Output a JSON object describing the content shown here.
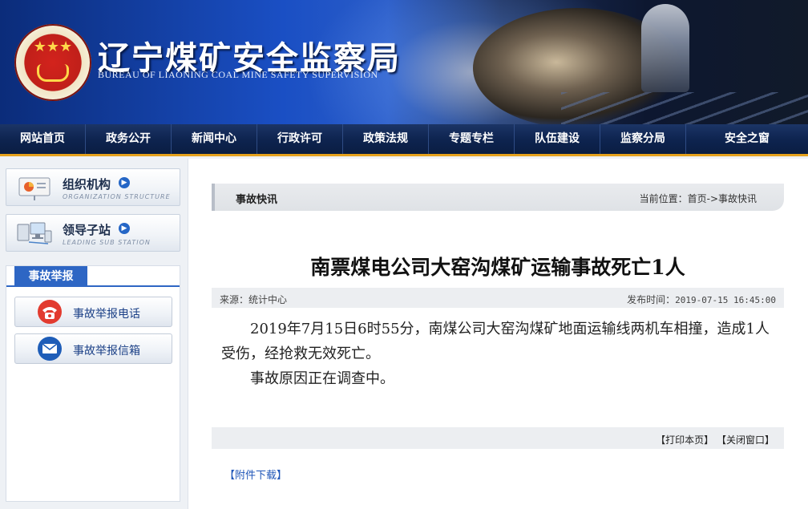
{
  "header": {
    "title": "辽宁煤矿安全监察局",
    "subtitle": "BUREAU OF LIAONING COAL MINE SAFETY SUPERVISION"
  },
  "nav": {
    "items": [
      {
        "label": "网站首页"
      },
      {
        "label": "政务公开"
      },
      {
        "label": "新闻中心"
      },
      {
        "label": "行政许可"
      },
      {
        "label": "政策法规"
      },
      {
        "label": "专题专栏"
      },
      {
        "label": "队伍建设"
      },
      {
        "label": "监察分局"
      },
      {
        "label": "安全之窗"
      }
    ]
  },
  "sidebar": {
    "org": {
      "label": "组织机构",
      "en": "ORGANIZATION STRUCTURE",
      "icon": "presentation-chart-icon"
    },
    "leaders": {
      "label": "领导子站",
      "en": "LEADING SUB STATION",
      "icon": "computer-network-icon"
    },
    "report": {
      "tab_label": "事故举报",
      "phone_label": "事故举报电话",
      "phone_icon": "telephone-icon",
      "mail_label": "事故举报信箱",
      "mail_icon": "envelope-icon"
    }
  },
  "main": {
    "section_title": "事故快讯",
    "location": "当前位置：首页->事故快讯",
    "article": {
      "title": "南票煤电公司大窑沟煤矿运输事故死亡1人",
      "source": "来源：统计中心",
      "date_label": "发布时间：",
      "date_value": "2019-07-15 16:45:00",
      "paragraphs": [
        "2019年7月15日6时55分，南煤公司大窑沟煤矿地面运输线两机车相撞，造成1人受伤，经抢救无效死亡。",
        "事故原因正在调查中。"
      ]
    },
    "print_label": "【打印本页】",
    "close_label": "【关闭窗口】",
    "attachment_label": "【附件下载】"
  },
  "colors": {
    "nav_bg": "#0e2450",
    "nav_accent": "#e5a11c",
    "report_tab": "#2e66c4",
    "link": "#1f56b8"
  }
}
